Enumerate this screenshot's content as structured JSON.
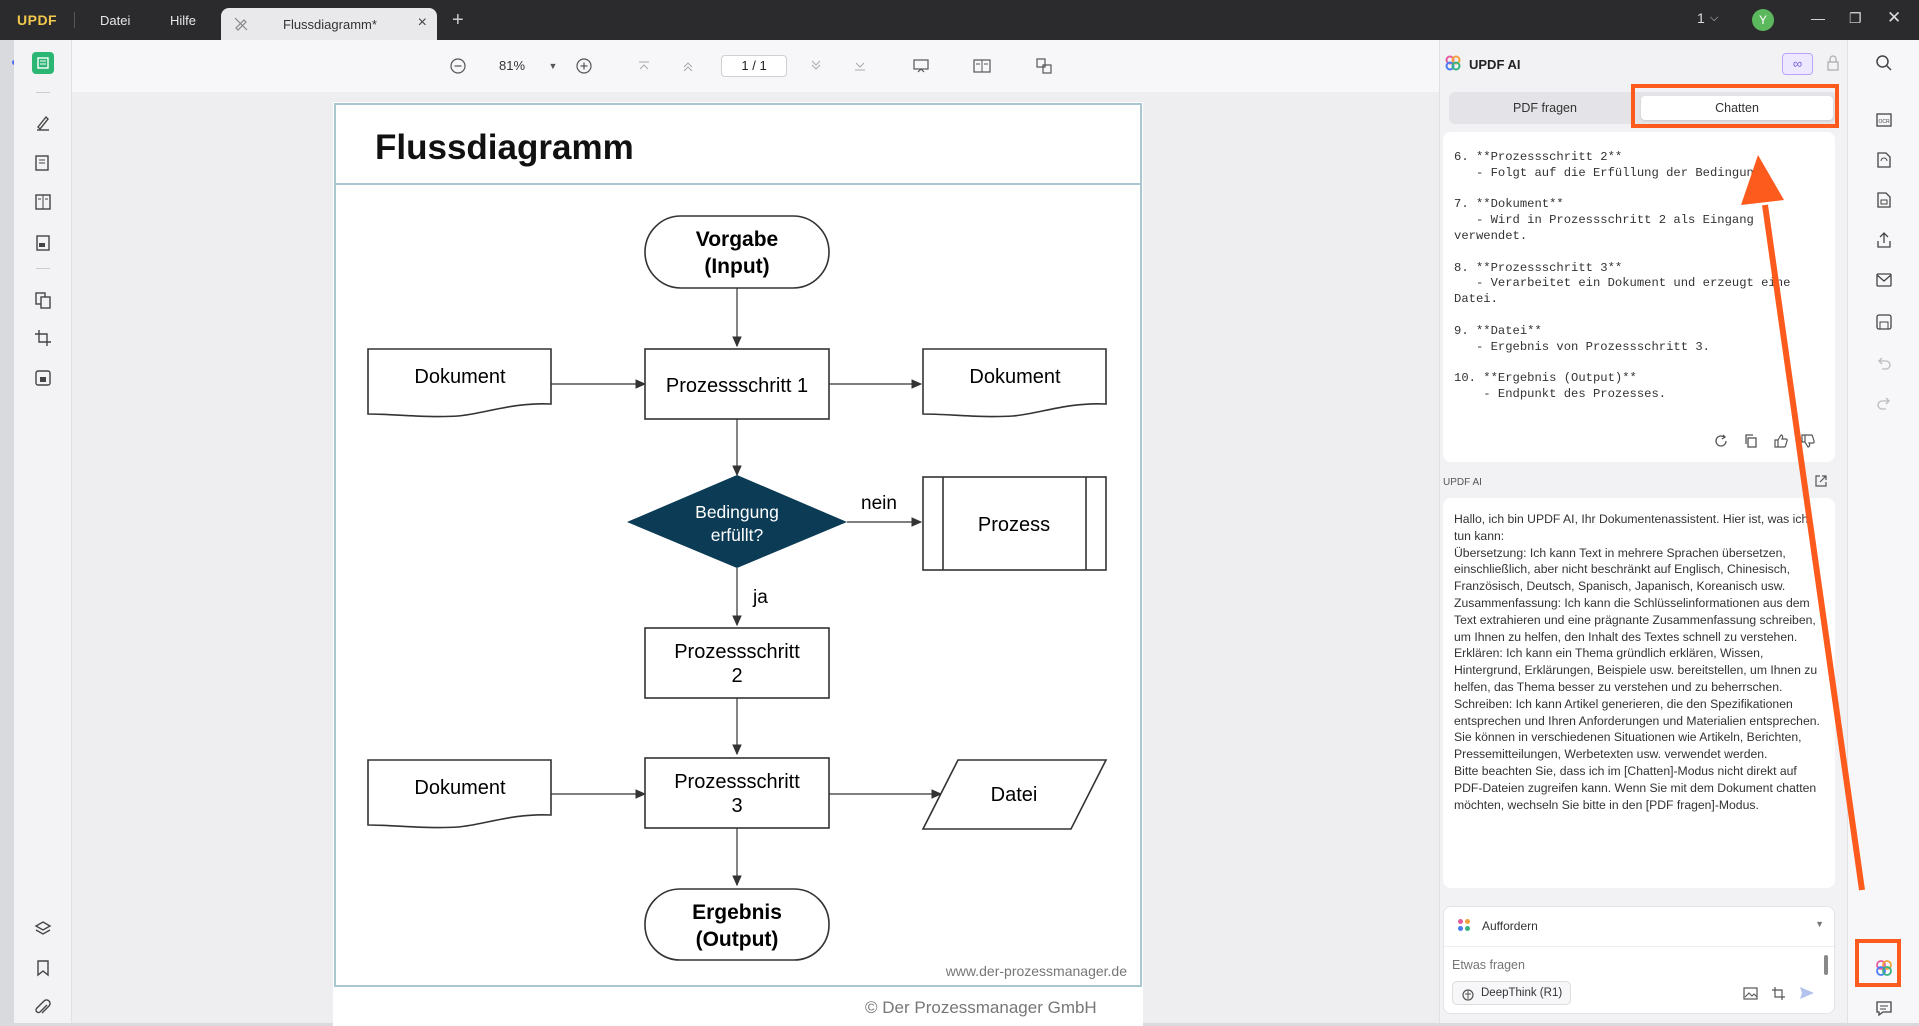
{
  "app": {
    "logo": "UPDF",
    "menu": [
      "Datei",
      "Hilfe"
    ],
    "tab_title": "Flussdiagramm*",
    "page_indicator": "1",
    "avatar_letter": "Y"
  },
  "toolbar": {
    "zoom": "81%",
    "page_current": "1",
    "page_sep": "/",
    "page_total": "1"
  },
  "document": {
    "title": "Flussdiagramm",
    "nodes": {
      "start": [
        "Vorgabe",
        "(Input)"
      ],
      "doc1": "Dokument",
      "step1": "Prozessschritt 1",
      "doc2": "Dokument",
      "decision": [
        "Bedingung",
        "erfüllt?"
      ],
      "no": "nein",
      "process": "Prozess",
      "yes": "ja",
      "step2": [
        "Prozessschritt",
        "2"
      ],
      "doc3": "Dokument",
      "step3": [
        "Prozessschritt",
        "3"
      ],
      "file": "Datei",
      "end": [
        "Ergebnis",
        "(Output)"
      ]
    },
    "website": "www.der-prozessmanager.de",
    "copyright": "© Der Prozessmanager GmbH"
  },
  "ai_panel": {
    "title": "UPDF AI",
    "tabs": [
      "PDF fragen",
      "Chatten"
    ],
    "active_tab": "Chatten",
    "response_text": "6. **Prozessschritt 2**\n   - Folgt auf die Erfüllung der Bedingung.\n\n7. **Dokument**\n   - Wird in Prozessschritt 2 als Eingang\nverwendet.\n\n8. **Prozessschritt 3**\n   - Verarbeitet ein Dokument und erzeugt eine\nDatei.\n\n9. **Datei**\n   - Ergebnis von Prozessschritt 3.\n\n10. **Ergebnis (Output)**\n    - Endpunkt des Prozesses.",
    "section_label": "UPDF AI",
    "intro_paragraphs": [
      "Hallo, ich bin UPDF AI, Ihr Dokumentenassistent. Hier ist, was ich tun kann:",
      "Übersetzung: Ich kann Text in mehrere Sprachen übersetzen, einschließlich, aber nicht beschränkt auf Englisch, Chinesisch, Französisch, Deutsch, Spanisch, Japanisch, Koreanisch usw.",
      "Zusammenfassung: Ich kann die Schlüsselinformationen aus dem Text extrahieren und eine prägnante Zusammenfassung schreiben, um Ihnen zu helfen, den Inhalt des Textes schnell zu verstehen.",
      "Erklären: Ich kann ein Thema gründlich erklären, Wissen, Hintergrund, Erklärungen, Beispiele usw. bereitstellen, um Ihnen zu helfen, das Thema besser zu verstehen und zu beherrschen.",
      "Schreiben: Ich kann Artikel generieren, die den Spezifikationen entsprechen und Ihren Anforderungen und Materialien entsprechen. Sie können in verschiedenen Situationen wie Artikeln, Berichten, Pressemitteilungen, Werbetexten usw. verwendet werden.",
      "Bitte beachten Sie, dass ich im [Chatten]-Modus nicht direkt auf PDF-Dateien zugreifen kann. Wenn Sie mit dem Dokument chatten möchten, wechseln Sie bitte in den [PDF fragen]-Modus."
    ],
    "prompt_selector": "Auffordern",
    "input_placeholder": "Etwas fragen",
    "deepthink_label": "DeepThink (R1)"
  },
  "colors": {
    "accent_annotation": "#fd5a1e",
    "decision_fill": "#0c3b55",
    "titlebar": "#2b2b2e"
  }
}
